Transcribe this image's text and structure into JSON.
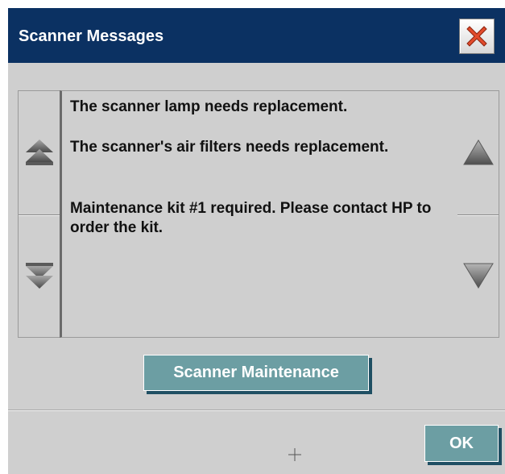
{
  "dialog": {
    "title": "Scanner Messages",
    "close_icon": "close-x-icon"
  },
  "messages": [
    "The scanner lamp needs replacement.",
    "The scanner's air filters needs replacement.",
    "Maintenance kit #1 required. Please contact HP to order the kit."
  ],
  "scroll_controls": {
    "left_top_icon": "double-up-arrow-icon",
    "left_bottom_icon": "double-down-arrow-icon",
    "right_top_icon": "up-arrow-icon",
    "right_bottom_icon": "down-arrow-icon"
  },
  "buttons": {
    "maintenance_label": "Scanner Maintenance",
    "ok_label": "OK"
  },
  "colors": {
    "title_bar": "#0b3162",
    "dialog_bg": "#cfcfcf",
    "button_bg": "#6c9ea3",
    "button_shadow": "#1f4f63",
    "close_x": "#e24b2b"
  }
}
